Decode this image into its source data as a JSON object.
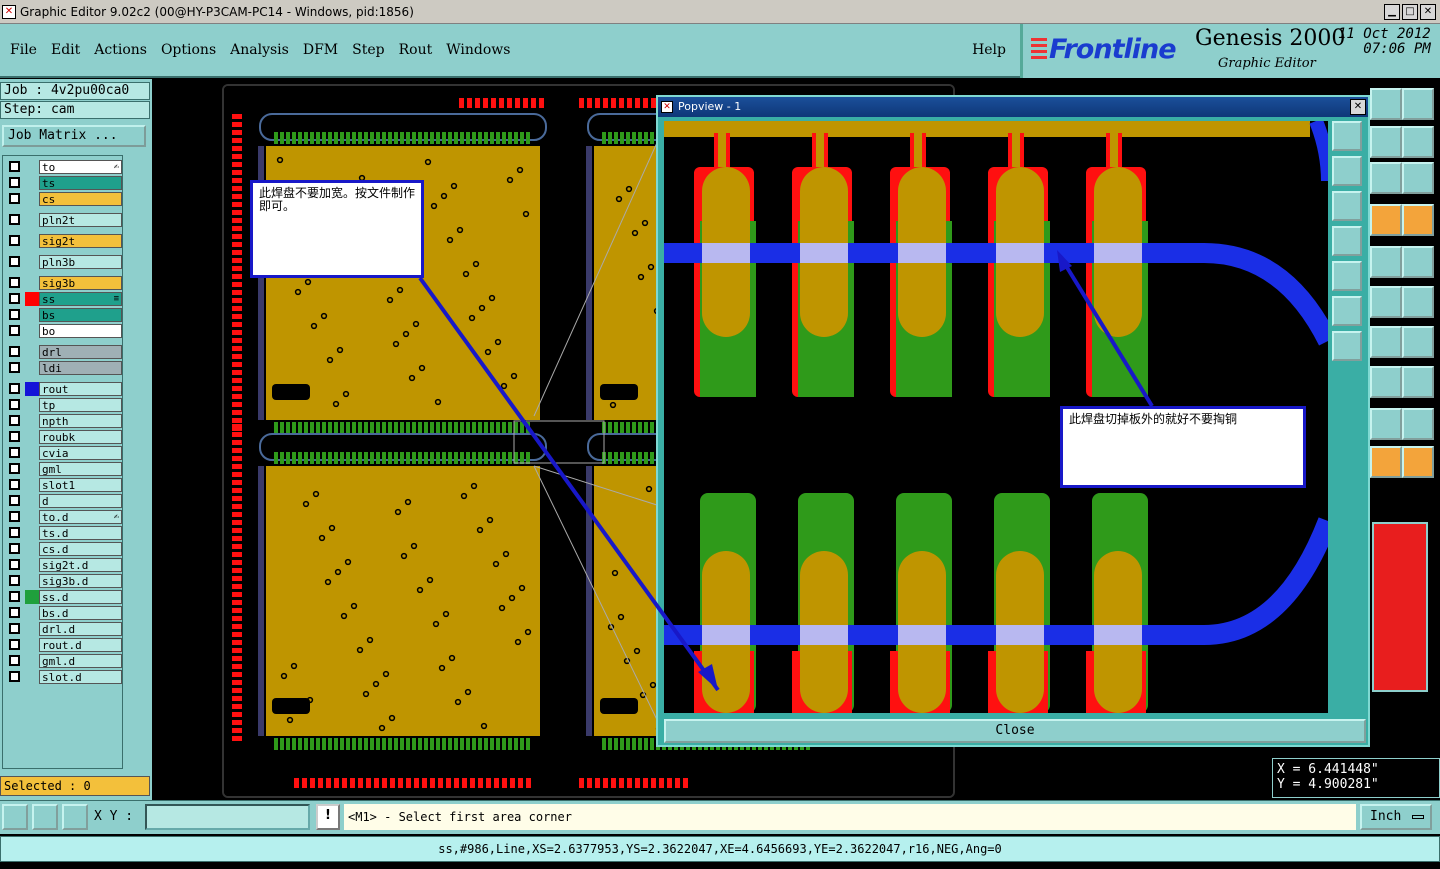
{
  "window": {
    "title": "Graphic Editor 9.02c2 (00@HY-P3CAM-PC14 - Windows, pid:1856)"
  },
  "menu": {
    "items": [
      "File",
      "Edit",
      "Actions",
      "Options",
      "Analysis",
      "DFM",
      "Step",
      "Rout",
      "Windows"
    ],
    "help": "Help"
  },
  "brand": {
    "logo": "Frontline",
    "product": "Genesis 2000",
    "subtitle": "Graphic Editor",
    "date": "11 Oct 2012",
    "time": "07:06 PM"
  },
  "job": {
    "job_line": "Job : 4v2pu00ca0",
    "step_line": "Step: cam",
    "matrix_button": "Job Matrix ..."
  },
  "layers": [
    {
      "name": "to",
      "color": "#ffffff",
      "tag": "✍"
    },
    {
      "name": "ts",
      "color": "#1fa08c"
    },
    {
      "name": "cs",
      "color": "#f3c03b"
    },
    {
      "name": "pln2t",
      "color": "#b6e8e3"
    },
    {
      "name": "sig2t",
      "color": "#f3c03b"
    },
    {
      "name": "pln3b",
      "color": "#b6e8e3"
    },
    {
      "name": "sig3b",
      "color": "#f3c03b"
    },
    {
      "name": "ss",
      "color": "#1fa08c",
      "swatch": "#ff0000",
      "tag": "≡"
    },
    {
      "name": "bs",
      "color": "#1fa08c"
    },
    {
      "name": "bo",
      "color": "#ffffff"
    },
    {
      "name": "drl",
      "color": "#9fb0b5"
    },
    {
      "name": "ldi",
      "color": "#9fb0b5"
    },
    {
      "name": "rout",
      "color": "#b6e8e3",
      "swatch": "#1414d8"
    },
    {
      "name": "tp",
      "color": "#b6e8e3"
    },
    {
      "name": "npth",
      "color": "#b6e8e3"
    },
    {
      "name": "roubk",
      "color": "#b6e8e3"
    },
    {
      "name": "cvia",
      "color": "#b6e8e3"
    },
    {
      "name": "gml",
      "color": "#b6e8e3"
    },
    {
      "name": "slot1",
      "color": "#b6e8e3"
    },
    {
      "name": "d",
      "color": "#b6e8e3"
    },
    {
      "name": "to.d",
      "color": "#b6e8e3",
      "tag": "✍"
    },
    {
      "name": "ts.d",
      "color": "#b6e8e3"
    },
    {
      "name": "cs.d",
      "color": "#b6e8e3"
    },
    {
      "name": "sig2t.d",
      "color": "#b6e8e3"
    },
    {
      "name": "sig3b.d",
      "color": "#b6e8e3"
    },
    {
      "name": "ss.d",
      "color": "#b6e8e3",
      "swatch": "#1fa03c"
    },
    {
      "name": "bs.d",
      "color": "#b6e8e3"
    },
    {
      "name": "drl.d",
      "color": "#b6e8e3"
    },
    {
      "name": "rout.d",
      "color": "#b6e8e3"
    },
    {
      "name": "gml.d",
      "color": "#b6e8e3"
    },
    {
      "name": "slot.d",
      "color": "#b6e8e3"
    }
  ],
  "selected": "Selected : 0",
  "popview": {
    "title": "Popview - 1",
    "close_label": "Close",
    "annotation": "此焊盘切掉板外的就好不要掏铜"
  },
  "board_annotation": "此焊盘不要加宽。按文件制作即可。",
  "coords": {
    "x": "X = 6.441448\"",
    "y": "Y = 4.900281\""
  },
  "bottom": {
    "xy_label": "X Y :",
    "xy_value": "",
    "prompt": "<M1> - Select first area corner",
    "units": "Inch"
  },
  "status": "ss,#986,Line,XS=2.6377953,YS=2.3622047,XE=4.6456693,YE=2.3622047,r16,NEG,Ang=0",
  "colors": {
    "pad_gold": "#bf9500",
    "solder_green": "#2f9a1a",
    "trace_blue": "#1a2ee6",
    "pad_red": "#ff1010",
    "panel_cyan": "#8ecfcc"
  }
}
